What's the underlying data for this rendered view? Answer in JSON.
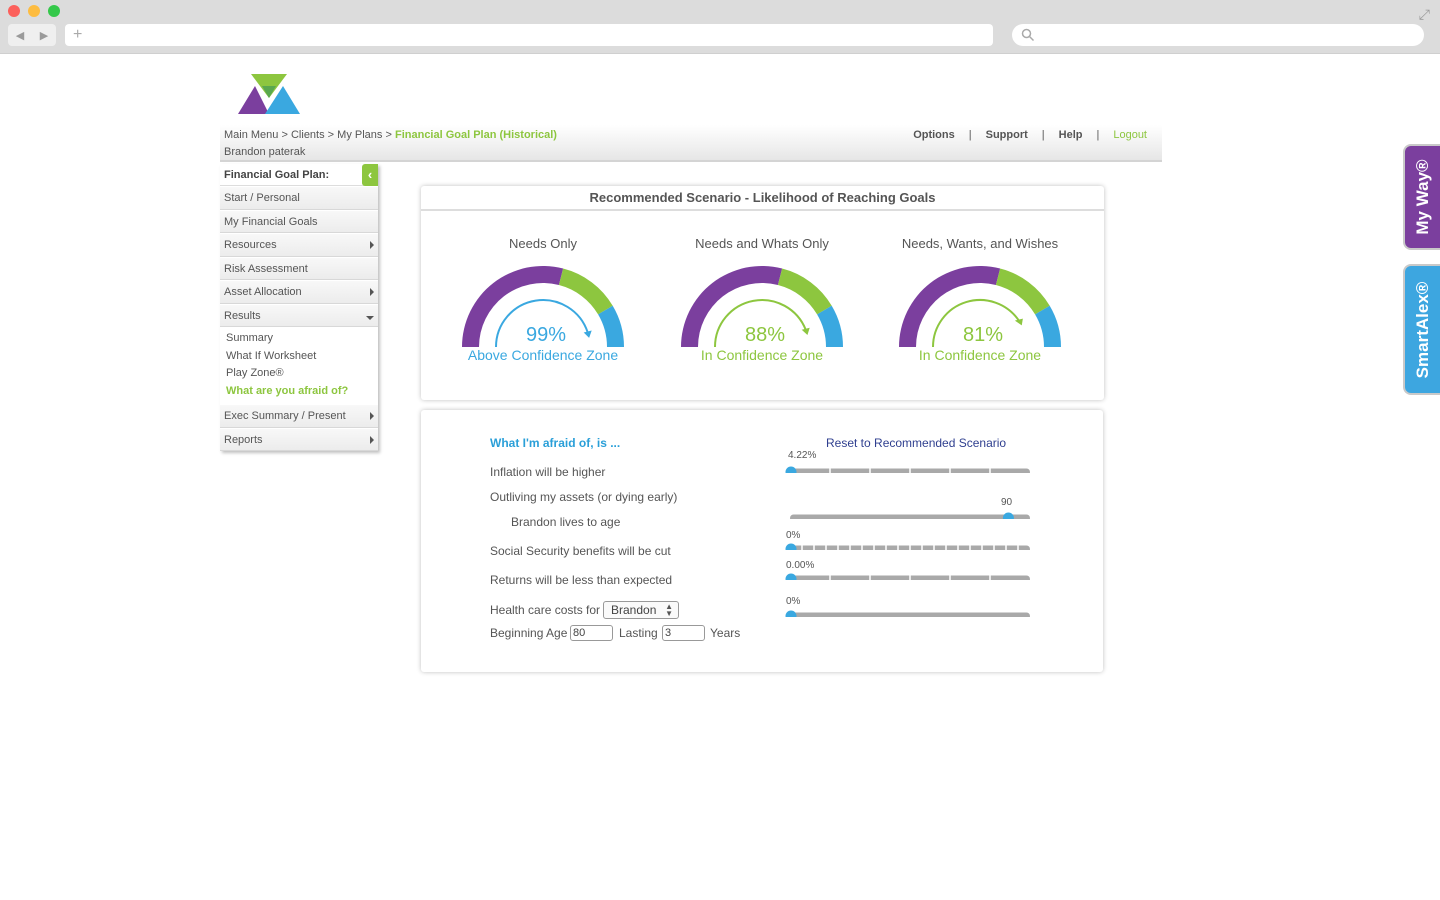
{
  "browser": {
    "new_tab": "+",
    "back": "◀",
    "forward": "▶",
    "fullscreen": "⤢"
  },
  "header": {
    "breadcrumb": [
      "Main Menu",
      "Clients",
      "My Plans"
    ],
    "breadcrumb_sep": ">",
    "current_page": "Financial Goal Plan (Historical)",
    "client_name": "Brandon paterak",
    "links": {
      "options": "Options",
      "support": "Support",
      "help": "Help",
      "logout": "Logout"
    },
    "separator": "|"
  },
  "sidebar": {
    "title": "Financial Goal Plan:",
    "toggle": "‹",
    "items": [
      "Start / Personal",
      "My Financial Goals",
      "Resources",
      "Risk Assessment",
      "Asset Allocation",
      "Results"
    ],
    "results_sub": [
      "Summary",
      "What If Worksheet",
      "Play Zone®",
      "What are you afraid of?"
    ],
    "items_after": [
      "Exec Summary / Present",
      "Reports"
    ]
  },
  "scenario": {
    "title": "Recommended Scenario - Likelihood of Reaching Goals",
    "gauges": [
      {
        "title": "Needs Only",
        "percent": 99,
        "label": "99%",
        "zone": "Above Confidence Zone",
        "color": "#3aa8e0"
      },
      {
        "title": "Needs and Whats Only",
        "percent": 88,
        "label": "88%",
        "zone": "In Confidence Zone",
        "color": "#8dc63f"
      },
      {
        "title": "Needs, Wants, and Wishes",
        "percent": 81,
        "label": "81%",
        "zone": "In Confidence Zone",
        "color": "#8dc63f"
      }
    ],
    "colors": {
      "purple": "#7b3f9e",
      "green": "#8dc63f",
      "blue": "#3aa8e0"
    }
  },
  "afraid": {
    "title": "What I'm afraid of, is ...",
    "reset": "Reset to Recommended Scenario",
    "inflation_label": "Inflation will be higher",
    "outliving_label": "Outliving my assets (or dying early)",
    "lives_label": "Brandon lives to age",
    "ss_label": "Social Security benefits will be cut",
    "returns_label": "Returns will be less than expected",
    "health_label": "Health care costs for",
    "health_person": "Brandon",
    "beginning_label": "Beginning Age",
    "beginning_value": "80",
    "lasting_label": "Lasting",
    "lasting_value": "3",
    "years_label": "Years",
    "inflation_value": "4.22%",
    "age_value": "90",
    "ss_value": "0%",
    "returns_value": "0.00%",
    "health_value": "0%",
    "slider_levels": {
      "inflation": 0.0,
      "age": 0.91,
      "ss": 0.0,
      "returns": 0.0,
      "health": 0.0
    }
  },
  "tabs": {
    "myway": "My Way®",
    "smartalex": "SmartAlex®"
  }
}
